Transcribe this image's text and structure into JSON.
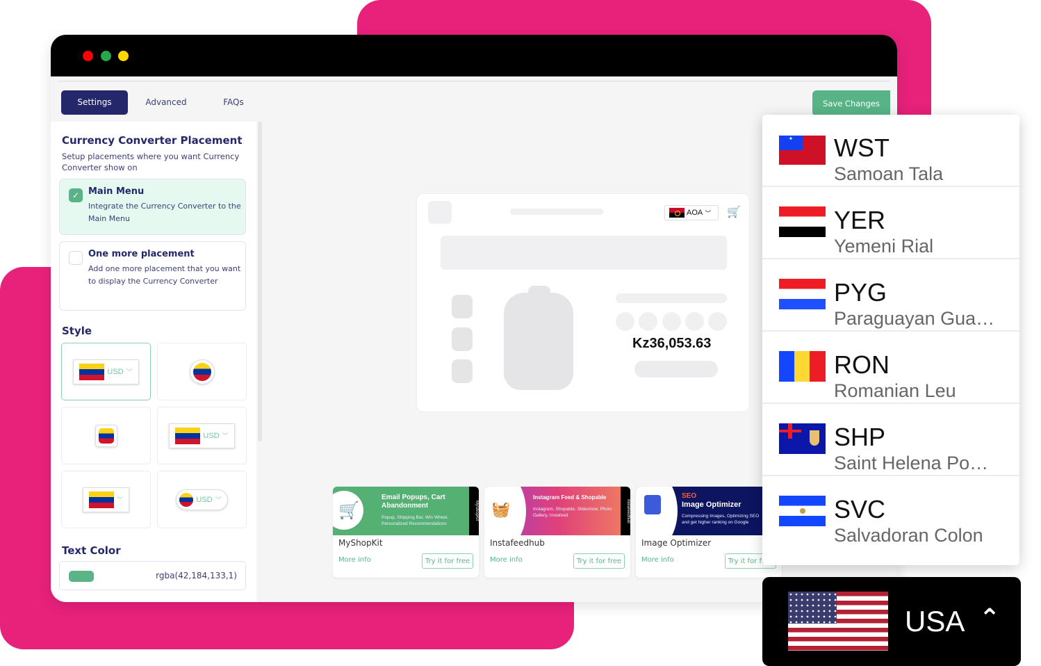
{
  "colors": {
    "accent_pink": "#e8217b",
    "navy": "#24286b",
    "green": "#58b486"
  },
  "window": {
    "controls": [
      "close",
      "minimize",
      "maximize"
    ]
  },
  "tabs": [
    {
      "label": "Settings",
      "active": true
    },
    {
      "label": "Advanced",
      "active": false
    },
    {
      "label": "FAQs",
      "active": false
    }
  ],
  "toolbar": {
    "save_label": "Save Changes"
  },
  "sidebar": {
    "placement_title": "Currency Converter Placement",
    "placement_desc": "Setup placements where you want Currency Converter show on",
    "placements": [
      {
        "title": "Main Menu",
        "desc": "Integrate the Currency Converter to the Main Menu",
        "checked": true
      },
      {
        "title": "One more placement",
        "desc": "Add one more placement that you want to display the Currency Converter",
        "checked": false
      }
    ],
    "style_title": "Style",
    "style_options": [
      {
        "type": "flag-code-dropdown",
        "code": "USD",
        "selected": true
      },
      {
        "type": "round-flag",
        "code": "",
        "selected": false
      },
      {
        "type": "square-flag",
        "code": "",
        "selected": false
      },
      {
        "type": "flag-code-dropdown-wide",
        "code": "USD",
        "selected": false
      },
      {
        "type": "flag-dropdown",
        "code": "",
        "selected": false
      },
      {
        "type": "pill-round-flag-code",
        "code": "USD",
        "selected": false
      }
    ],
    "text_color_title": "Text Color",
    "text_color_value": "rgba(42,184,133,1)",
    "text_color_hex": "#2ab885"
  },
  "preview": {
    "currency_code": "AOA",
    "price": "Kz36,053.63"
  },
  "promos": [
    {
      "name": "MyShopKit",
      "headline": "Email Popups, Cart Abandonment",
      "sub": "Popup, Shipping Bar, Win Wheel, Personalized Recommendations",
      "side": "MyShopKit",
      "more": "More info",
      "try": "Try it for free"
    },
    {
      "name": "Instafeedhub",
      "headline": "Instagram Feed & Shopable",
      "sub": "Instagram, Shopable, Slideshow, Photo Gallery, Instafeed",
      "side": "Instafeedhub",
      "more": "More info",
      "try": "Try it for free"
    },
    {
      "name": "Image Optimizer",
      "headline_tag": "SEO",
      "headline": "Image Optimizer",
      "sub": "Compressing Images, Optimizing SEO and get higher ranking on Google",
      "more": "More info",
      "try": "Try it for free"
    }
  ],
  "currency_dropdown": {
    "items": [
      {
        "code": "WST",
        "name": "Samoan Tala",
        "flag": "samoa"
      },
      {
        "code": "YER",
        "name": "Yemeni Rial",
        "flag": "yemen"
      },
      {
        "code": "PYG",
        "name": "Paraguayan Gua…",
        "flag": "paraguay"
      },
      {
        "code": "RON",
        "name": "Romanian Leu",
        "flag": "romania"
      },
      {
        "code": "SHP",
        "name": "Saint Helena Po…",
        "flag": "saint-helena"
      },
      {
        "code": "SVC",
        "name": "Salvadoran Colon",
        "flag": "el-salvador"
      }
    ]
  },
  "currency_selector": {
    "label": "USA",
    "flag": "usa",
    "chevron": "^"
  }
}
